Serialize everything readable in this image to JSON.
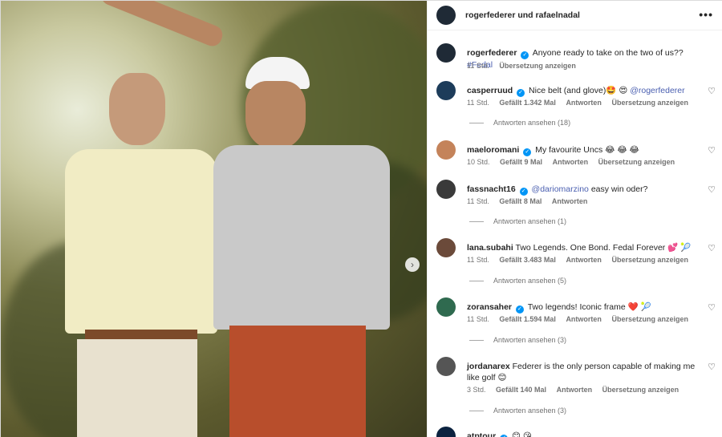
{
  "header": {
    "title": "rogerfederer und rafaelnadal",
    "more": "•••"
  },
  "photo": {
    "next_arrow": "›"
  },
  "caption": {
    "user": "rogerfederer",
    "text": "Anyone ready to take on the two of us??",
    "hashtag": "#Fedal",
    "time": "11 Std.",
    "translate": "Übersetzung anzeigen"
  },
  "comments": [
    {
      "user": "casperruud",
      "verified": true,
      "text": "Nice belt (and glove)🤩 😍",
      "mention": "@rogerfederer",
      "time": "11 Std.",
      "likes": "Gefällt 1.342 Mal",
      "reply": "Antworten",
      "translate": "Übersetzung anzeigen",
      "replies": "Antworten ansehen (18)",
      "avatar_color": "#1d3c5a"
    },
    {
      "user": "maeloromani",
      "verified": true,
      "text": "My favourite Uncs 😂 😂 😂",
      "time": "10 Std.",
      "likes": "Gefällt 9 Mal",
      "reply": "Antworten",
      "translate": "Übersetzung anzeigen",
      "avatar_color": "#c4835a"
    },
    {
      "user": "fassnacht16",
      "verified": true,
      "mention": "@dariomarzino",
      "text": "easy win oder?",
      "time": "11 Std.",
      "likes": "Gefällt 8 Mal",
      "reply": "Antworten",
      "replies": "Antworten ansehen (1)",
      "avatar_color": "#3a3a3a"
    },
    {
      "user": "lana.subahi",
      "verified": false,
      "text": "Two Legends. One Bond. Fedal Forever 💕 🎾",
      "time": "11 Std.",
      "likes": "Gefällt 3.483 Mal",
      "reply": "Antworten",
      "translate": "Übersetzung anzeigen",
      "replies": "Antworten ansehen (5)",
      "avatar_color": "#6b4a3a"
    },
    {
      "user": "zoransaher",
      "verified": true,
      "text": "Two legends! Iconic frame ❤️ 🎾",
      "time": "11 Std.",
      "likes": "Gefällt 1.594 Mal",
      "reply": "Antworten",
      "translate": "Übersetzung anzeigen",
      "replies": "Antworten ansehen (3)",
      "avatar_color": "#2f6a4f"
    },
    {
      "user": "jordanarex",
      "verified": false,
      "text": "Federer is the only person capable of making me like golf 😊",
      "time": "3 Std.",
      "likes": "Gefällt 140 Mal",
      "reply": "Antworten",
      "translate": "Übersetzung anzeigen",
      "replies": "Antworten ansehen (3)",
      "avatar_color": "#555"
    },
    {
      "user": "atptour",
      "verified": true,
      "text": "😊 😘",
      "avatar_color": "#0c2340"
    }
  ],
  "icons": {
    "heart": "♡",
    "verified": "✓"
  }
}
